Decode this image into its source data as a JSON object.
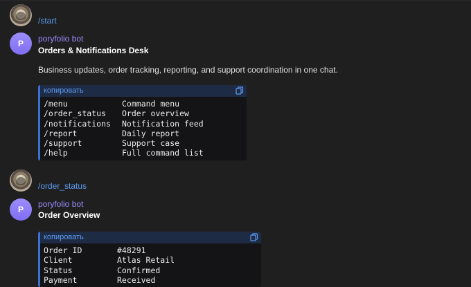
{
  "messages": [
    {
      "type": "user",
      "command": "/start"
    },
    {
      "type": "bot",
      "name": "poryfolio bot",
      "avatar_letter": "P",
      "title": "Orders & Notifications Desk",
      "description": "Business updates, order tracking, reporting, and support coordination in one chat.",
      "code": {
        "copy_label": "копировать",
        "rows": [
          {
            "key": "/menu",
            "value": "Command menu"
          },
          {
            "key": "/order_status",
            "value": "Order overview"
          },
          {
            "key": "/notifications",
            "value": "Notification feed"
          },
          {
            "key": "/report",
            "value": "Daily report"
          },
          {
            "key": "/support",
            "value": "Support case"
          },
          {
            "key": "/help",
            "value": "Full command list"
          }
        ]
      }
    },
    {
      "type": "user",
      "command": "/order_status"
    },
    {
      "type": "bot",
      "name": "poryfolio bot",
      "avatar_letter": "P",
      "title": "Order Overview",
      "code": {
        "copy_label": "копировать",
        "rows": [
          {
            "key": "Order ID",
            "value": "#48291"
          },
          {
            "key": "Client",
            "value": "Atlas Retail"
          },
          {
            "key": "Status",
            "value": "Confirmed"
          },
          {
            "key": "Payment",
            "value": "Received"
          }
        ]
      }
    }
  ],
  "colors": {
    "background": "#1f1f20",
    "accent_link": "#5d9bf0",
    "bot_name": "#9b8cff",
    "code_border": "#3b6fd1"
  },
  "icons": {
    "user_avatar": "user-photo-avatar",
    "bot_avatar": "letter-avatar",
    "copy": "copy-icon"
  }
}
